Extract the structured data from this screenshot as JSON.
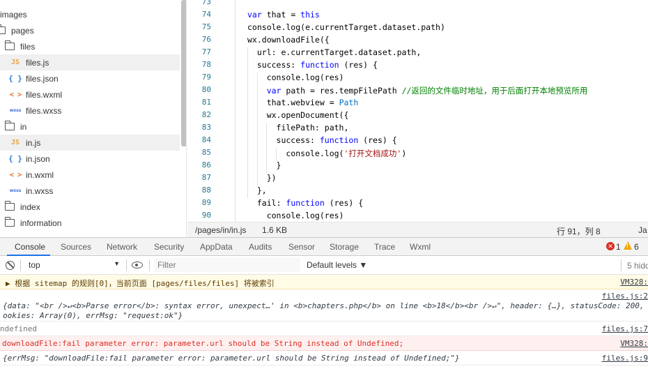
{
  "file_tree": {
    "items": [
      {
        "name": "images",
        "kind": "folder"
      },
      {
        "name": "pages",
        "kind": "folder"
      },
      {
        "name": "files",
        "kind": "folder"
      },
      {
        "name": "files.js",
        "kind": "js",
        "badge": "JS"
      },
      {
        "name": "files.json",
        "kind": "json",
        "badge": "{ }"
      },
      {
        "name": "files.wxml",
        "kind": "wxml",
        "badge": "< >"
      },
      {
        "name": "files.wxss",
        "kind": "wxss",
        "badge": "wxss"
      },
      {
        "name": "in",
        "kind": "folder"
      },
      {
        "name": "in.js",
        "kind": "js",
        "badge": "JS"
      },
      {
        "name": "in.json",
        "kind": "json",
        "badge": "{ }"
      },
      {
        "name": "in.wxml",
        "kind": "wxml",
        "badge": "< >"
      },
      {
        "name": "in.wxss",
        "kind": "wxss",
        "badge": "wxss"
      },
      {
        "name": "index",
        "kind": "folder"
      },
      {
        "name": "information",
        "kind": "folder"
      }
    ]
  },
  "editor": {
    "line_numbers": [
      "73",
      "74",
      "75",
      "76",
      "77",
      "78",
      "79",
      "80",
      "81",
      "82",
      "83",
      "84",
      "85",
      "86",
      "87",
      "88",
      "89",
      "90"
    ],
    "lines": [
      "",
      "var that = this",
      "console.log(e.currentTarget.dataset.path)",
      "wx.downloadFile({",
      "  url: e.currentTarget.dataset.path,",
      "  success: function (res) {",
      "    console.log(res)",
      "    var path = res.tempFilePath //返回的文件临时地址，用于后面打开本地预览所用",
      "    that.webview = Path",
      "    wx.openDocument({",
      "      filePath: path,",
      "      success: function (res) {",
      "        console.log('打开文档成功')",
      "      }",
      "    })",
      "  },",
      "  fail: function (res) {",
      "    console.log(res)"
    ]
  },
  "statusbar": {
    "path": "/pages/in/in.js",
    "size": "1.6 KB",
    "position": "行 91，列 8",
    "lang": "Ja"
  },
  "devtools": {
    "tabs": [
      "Console",
      "Sources",
      "Network",
      "Security",
      "AppData",
      "Audits",
      "Sensor",
      "Storage",
      "Trace",
      "Wxml"
    ],
    "active_tab": "Console",
    "error_count": "1",
    "warning_count": "6"
  },
  "console_toolbar": {
    "context": "top",
    "filter_placeholder": "Filter",
    "levels": "Default levels ▼",
    "hidden": "5 hidd"
  },
  "messages": [
    {
      "level": "warning",
      "text": "▶ 根据 sitemap 的规则[0]，当前页面 [pages/files/files] 将被索引",
      "source": "VM328:"
    },
    {
      "level": "log",
      "text_line1": "{data: \"<br />↵<b>Parse error</b>:  syntax error, unexpect…' in <b>chapters.php</b> on line <b>18</b><br />↵\", header: {…}, statusCode: 200,",
      "text_line2": "ookies: Array(0), errMsg: \"request:ok\"}",
      "source": "files.js:2"
    },
    {
      "level": "log",
      "text": "ndefined",
      "source": "files.js:7"
    },
    {
      "level": "error",
      "text": "downloadFile:fail parameter error: parameter.url should be String instead of Undefined;",
      "source": "VM328:"
    },
    {
      "level": "log",
      "text": "{errMsg: \"downloadFile:fail parameter error: parameter.url should be String instead of Undefined;\"}",
      "source": "files.js:9"
    }
  ],
  "colors": {
    "accent": "#1a73e8",
    "error": "#d93025",
    "warning_bg": "#fffbe5",
    "error_bg": "#fff0f0"
  }
}
